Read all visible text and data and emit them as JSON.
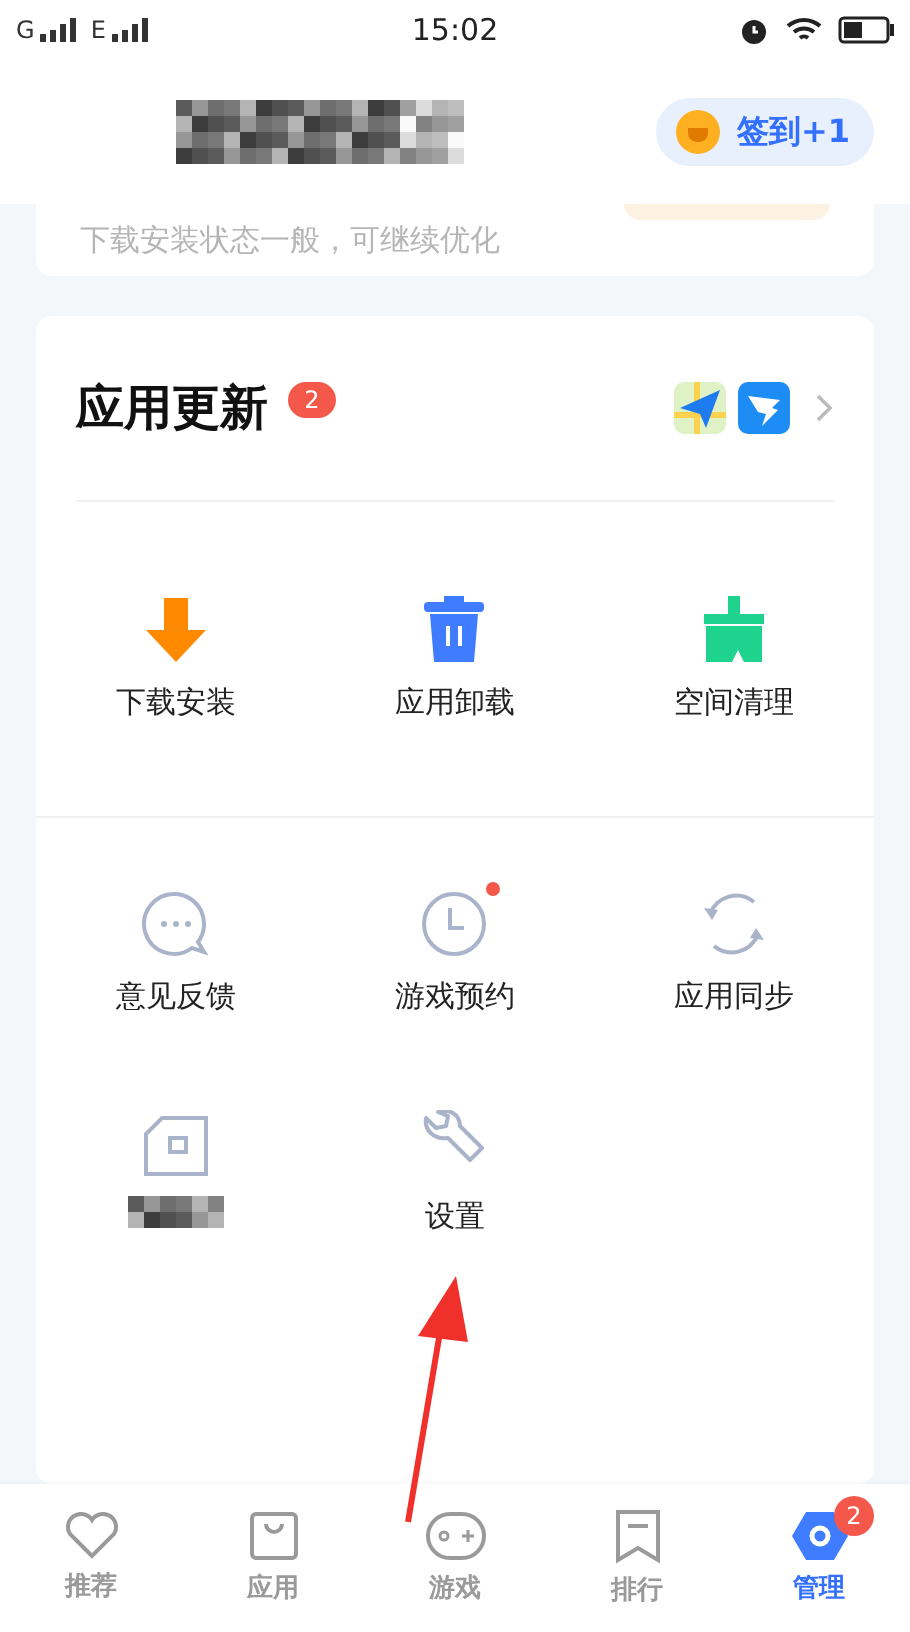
{
  "status_bar": {
    "carrier_1": "G",
    "carrier_2": "E",
    "time": "15:02"
  },
  "header": {
    "checkin_button": "签到+1"
  },
  "status_card": {
    "message": "下载安装状态一般，可继续优化"
  },
  "updates_card": {
    "title": "应用更新",
    "badge": "2",
    "tools": [
      {
        "label": "下载安装",
        "kind": "download",
        "dot": false
      },
      {
        "label": "应用卸载",
        "kind": "trash",
        "dot": false
      },
      {
        "label": "空间清理",
        "kind": "broom",
        "dot": false
      }
    ],
    "services": [
      {
        "label": "意见反馈",
        "kind": "chat",
        "dot": false
      },
      {
        "label": "游戏预约",
        "kind": "clock",
        "dot": true
      },
      {
        "label": "应用同步",
        "kind": "sync",
        "dot": false
      },
      {
        "kind": "card",
        "dot": false
      },
      {
        "label": "设置",
        "kind": "wrench",
        "dot": false
      }
    ]
  },
  "annotation": {
    "kind": "arrow"
  },
  "bottom_nav": [
    {
      "label": "推荐",
      "kind": "heart",
      "selected": false
    },
    {
      "label": "应用",
      "kind": "bag",
      "selected": false
    },
    {
      "label": "游戏",
      "kind": "gamepad",
      "selected": false
    },
    {
      "label": "排行",
      "kind": "bookmark",
      "selected": false
    },
    {
      "label": "管理",
      "kind": "hex",
      "selected": true,
      "badge": "2"
    }
  ]
}
